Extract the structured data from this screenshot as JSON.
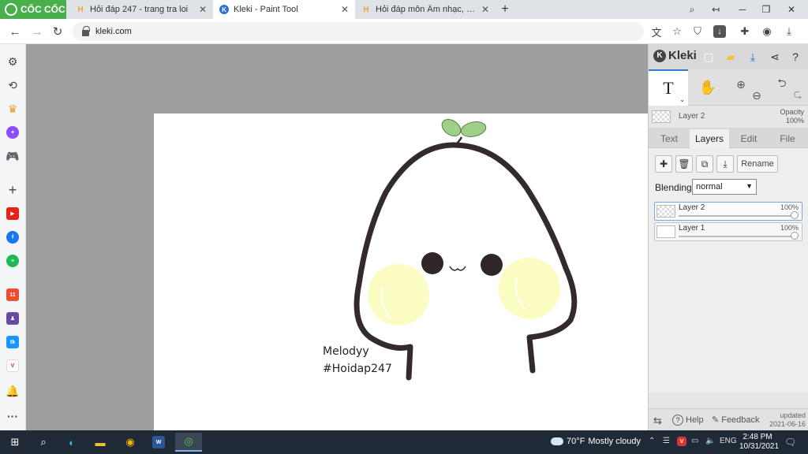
{
  "browser": {
    "brand": "CỐC CỐC",
    "tabs": [
      {
        "title": "Hỏi đáp 247 - trang tra loi",
        "favicon": "H"
      },
      {
        "title": "Kleki - Paint Tool",
        "favicon": "K"
      },
      {
        "title": "Hỏi đáp môn Âm nhạc, Mỹ th",
        "favicon": "H"
      }
    ],
    "new_tab": "+",
    "url": "kleki.com"
  },
  "canvas": {
    "signature_name": "Melodyy",
    "signature_tag": "#Hoidap247",
    "colors": {
      "outline": "#332b2b",
      "blush": "#fbfcc2",
      "sprout": "#9ed089",
      "eyes": "#2f2727"
    }
  },
  "kleki": {
    "brand": "Kleki",
    "current_layer": "Layer 2",
    "opacity_label": "Opacity",
    "opacity_value": "100%",
    "text_tool_glyph": "T",
    "tabs": [
      "Text",
      "Layers",
      "Edit",
      "File"
    ],
    "active_tab": "Layers",
    "rename_label": "Rename",
    "blending_label": "Blending",
    "blending_value": "normal",
    "layers": [
      {
        "name": "Layer 2",
        "opacity": "100%",
        "selected": true
      },
      {
        "name": "Layer 1",
        "opacity": "100%",
        "selected": false
      }
    ],
    "help_label": "Help",
    "feedback_label": "Feedback",
    "updated_label": "updated",
    "updated_date": "2021-06-16",
    "accent_color": "#2d7dd2"
  },
  "taskbar": {
    "weather_temp": "70°F",
    "weather_text": "Mostly cloudy",
    "language": "ENG",
    "time": "2:48 PM",
    "date": "10/31/2021"
  }
}
